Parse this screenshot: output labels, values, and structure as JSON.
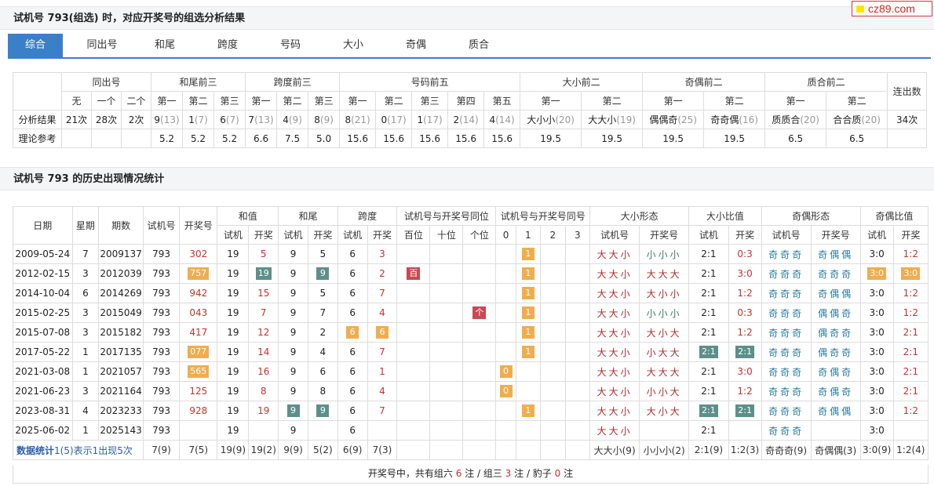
{
  "brand": "cz89.com",
  "title1": "试机号 793(组选) 时，对应开奖号的组选分析结果",
  "tabs": [
    "综合",
    "同出号",
    "和尾",
    "跨度",
    "号码",
    "大小",
    "奇偶",
    "质合"
  ],
  "t1": {
    "groups": [
      "同出号",
      "和尾前三",
      "跨度前三",
      "号码前五",
      "大小前二",
      "奇偶前二",
      "质合前二",
      "连出数"
    ],
    "sub": [
      "无",
      "一个",
      "二个",
      "第一",
      "第二",
      "第三",
      "第一",
      "第二",
      "第三",
      "第一",
      "第二",
      "第三",
      "第四",
      "第五",
      "第一",
      "第二",
      "第一",
      "第二",
      "第一",
      "第二"
    ],
    "rows": [
      {
        "label": "分析结果",
        "cells": [
          [
            "21次",
            ""
          ],
          [
            "28次",
            ""
          ],
          [
            "2次",
            ""
          ],
          [
            "9",
            "(13)"
          ],
          [
            "1",
            "(7)"
          ],
          [
            "6",
            "(7)"
          ],
          [
            "7",
            "(13)"
          ],
          [
            "4",
            "(9)"
          ],
          [
            "8",
            "(9)"
          ],
          [
            "8",
            "(21)"
          ],
          [
            "0",
            "(17)"
          ],
          [
            "1",
            "(17)"
          ],
          [
            "2",
            "(14)"
          ],
          [
            "4",
            "(14)"
          ],
          [
            "大小小",
            "(20)"
          ],
          [
            "大大小",
            "(19)"
          ],
          [
            "偶偶奇",
            "(25)"
          ],
          [
            "奇奇偶",
            "(16)"
          ],
          [
            "质质合",
            "(20)"
          ],
          [
            "合合质",
            "(20)"
          ],
          [
            "34次",
            ""
          ]
        ]
      },
      {
        "label": "理论参考",
        "cells": [
          [
            "",
            ""
          ],
          [
            "",
            ""
          ],
          [
            "",
            ""
          ],
          [
            "5.2",
            ""
          ],
          [
            "5.2",
            ""
          ],
          [
            "5.2",
            ""
          ],
          [
            "6.6",
            ""
          ],
          [
            "7.5",
            ""
          ],
          [
            "5.0",
            ""
          ],
          [
            "15.6",
            ""
          ],
          [
            "15.6",
            ""
          ],
          [
            "15.6",
            ""
          ],
          [
            "15.6",
            ""
          ],
          [
            "15.6",
            ""
          ],
          [
            "19.5",
            ""
          ],
          [
            "19.5",
            ""
          ],
          [
            "19.5",
            ""
          ],
          [
            "19.5",
            ""
          ],
          [
            "6.5",
            ""
          ],
          [
            "6.5",
            ""
          ],
          [
            "",
            ""
          ]
        ]
      }
    ]
  },
  "title2": "试机号 793 的历史出现情况统计",
  "t2": {
    "h1": [
      "日期",
      "星期",
      "期数",
      "试机号",
      "开奖号",
      "和值",
      "和尾",
      "跨度",
      "试机号与开奖号同位",
      "试机号与开奖号同号",
      "大小形态",
      "大小比值",
      "奇偶形态",
      "奇偶比值"
    ],
    "h2": [
      "试机",
      "开奖",
      "试机",
      "开奖",
      "试机",
      "开奖",
      "百位",
      "十位",
      "个位",
      "0",
      "1",
      "2",
      "3",
      "试机号",
      "开奖号",
      "试机",
      "开奖",
      "试机号",
      "开奖号",
      "试机",
      "开奖"
    ],
    "rows": [
      [
        "2009-05-24",
        "7",
        "2009137",
        "793",
        "302",
        "19",
        "5",
        "9",
        "5",
        "6",
        "3",
        "",
        "",
        "",
        "",
        "1",
        "",
        "",
        "大大小",
        "小小小",
        "2:1",
        "0:3",
        "奇奇奇",
        "奇偶偶",
        "3:0",
        "1:2"
      ],
      [
        "2012-02-15",
        "3",
        "2012039",
        "793",
        "757",
        "19",
        "19",
        "9",
        "9",
        "6",
        "2",
        "百",
        "",
        "",
        "",
        "1",
        "",
        "",
        "大大小",
        "大大大",
        "2:1",
        "3:0",
        "奇奇奇",
        "奇奇奇",
        "3:0",
        "3:0"
      ],
      [
        "2014-10-04",
        "6",
        "2014269",
        "793",
        "942",
        "19",
        "15",
        "9",
        "5",
        "6",
        "7",
        "",
        "",
        "",
        "",
        "1",
        "",
        "",
        "大大小",
        "大小小",
        "2:1",
        "1:2",
        "奇奇奇",
        "奇偶偶",
        "3:0",
        "1:2"
      ],
      [
        "2015-02-25",
        "3",
        "2015049",
        "793",
        "043",
        "19",
        "7",
        "9",
        "7",
        "6",
        "4",
        "",
        "",
        "个",
        "",
        "1",
        "",
        "",
        "大大小",
        "小小小",
        "2:1",
        "0:3",
        "奇奇奇",
        "偶偶奇",
        "3:0",
        "1:2"
      ],
      [
        "2015-07-08",
        "3",
        "2015182",
        "793",
        "417",
        "19",
        "12",
        "9",
        "2",
        "6",
        "6",
        "",
        "",
        "",
        "",
        "1",
        "",
        "",
        "大大小",
        "大小大",
        "2:1",
        "1:2",
        "奇奇奇",
        "偶奇奇",
        "3:0",
        "2:1"
      ],
      [
        "2017-05-22",
        "1",
        "2017135",
        "793",
        "077",
        "19",
        "14",
        "9",
        "4",
        "6",
        "7",
        "",
        "",
        "",
        "",
        "1",
        "",
        "",
        "大大小",
        "小大大",
        "2:1",
        "2:1",
        "奇奇奇",
        "偶奇奇",
        "3:0",
        "2:1"
      ],
      [
        "2021-03-08",
        "1",
        "2021057",
        "793",
        "565",
        "19",
        "16",
        "9",
        "6",
        "6",
        "1",
        "",
        "",
        "",
        "0",
        "",
        "",
        "",
        "大大小",
        "大大大",
        "2:1",
        "3:0",
        "奇奇奇",
        "奇偶奇",
        "3:0",
        "2:1"
      ],
      [
        "2021-06-23",
        "3",
        "2021164",
        "793",
        "125",
        "19",
        "8",
        "9",
        "8",
        "6",
        "4",
        "",
        "",
        "",
        "0",
        "",
        "",
        "",
        "大大小",
        "小小大",
        "2:1",
        "1:2",
        "奇奇奇",
        "奇偶奇",
        "3:0",
        "2:1"
      ],
      [
        "2023-08-31",
        "4",
        "2023233",
        "793",
        "928",
        "19",
        "19",
        "9",
        "9",
        "6",
        "7",
        "",
        "",
        "",
        "",
        "1",
        "",
        "",
        "大大小",
        "大小大",
        "2:1",
        "2:1",
        "奇奇奇",
        "奇偶偶",
        "3:0",
        "1:2"
      ],
      [
        "2025-06-02",
        "1",
        "2025143",
        "793",
        "",
        "19",
        "",
        "9",
        "",
        "6",
        "",
        "",
        "",
        "",
        "",
        "",
        "",
        "",
        "大大小",
        "",
        "2:1",
        "",
        "奇奇奇",
        "",
        "3:0",
        ""
      ]
    ],
    "stat_label": "数据统计",
    "stat_note": "1(5)表示1出现5次",
    "stat": [
      "7(9)",
      "7(5)",
      "19(9)",
      "19(2)",
      "9(9)",
      "5(2)",
      "6(9)",
      "7(3)",
      "",
      "",
      "",
      "",
      "",
      "",
      "",
      "大大小(9)",
      "小小小(2)",
      "2:1(9)",
      "1:2(3)",
      "奇奇奇(9)",
      "奇偶偶(3)",
      "3:0(9)",
      "1:2(4)"
    ]
  },
  "foot": {
    "pre": "开奖号中，共有组六 ",
    "n6": "6",
    "m1": " 注 / 组三 ",
    "n3": "3",
    "m2": " 注 / 豹子 ",
    "n0": "0",
    "post": " 注"
  }
}
